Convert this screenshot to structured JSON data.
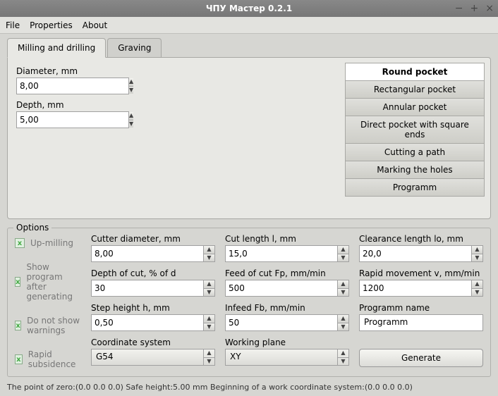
{
  "window": {
    "title": "ЧПУ Мастер 0.2.1"
  },
  "menu": {
    "file": "File",
    "properties": "Properties",
    "about": "About"
  },
  "tabs": {
    "milling": "Milling and drilling",
    "graving": "Graving"
  },
  "params": {
    "diameter_label": "Diameter, mm",
    "diameter_value": "8,00",
    "depth_label": "Depth, mm",
    "depth_value": "5,00"
  },
  "sidelist": {
    "round": "Round pocket",
    "rect": "Rectangular pocket",
    "annular": "Annular pocket",
    "direct": "Direct pocket with square ends",
    "cutpath": "Cutting a path",
    "marking": "Marking the holes",
    "programm": "Programm"
  },
  "options": {
    "legend": "Options",
    "upmilling": "Up-milling",
    "showprog": "Show program after generating",
    "nowarn": "Do not show warnings",
    "rapidsub": "Rapid subsidence",
    "cutter_d_label": "Cutter diameter, mm",
    "cutter_d_value": "8,00",
    "depthcut_label": "Depth of cut, % of d",
    "depthcut_value": "30",
    "steph_label": "Step height h, mm",
    "steph_value": "0,50",
    "coord_label": "Coordinate system",
    "coord_value": "G54",
    "cutlen_label": "Cut length l, mm",
    "cutlen_value": "15,0",
    "feed_label": "Feed of cut Fp, mm/min",
    "feed_value": "500",
    "infeed_label": "Infeed Fb, mm/min",
    "infeed_value": "50",
    "plane_label": "Working plane",
    "plane_value": "XY",
    "clear_label": "Clearance length lo, mm",
    "clear_value": "20,0",
    "rapid_label": "Rapid movement v, mm/min",
    "rapid_value": "1200",
    "prog_label": "Programm name",
    "prog_value": "Programm",
    "generate": "Generate"
  },
  "status": "The point of zero:(0.0  0.0  0.0)    Safe height:5.00 mm   Beginning of a work coordinate system:(0.0  0.0  0.0)"
}
